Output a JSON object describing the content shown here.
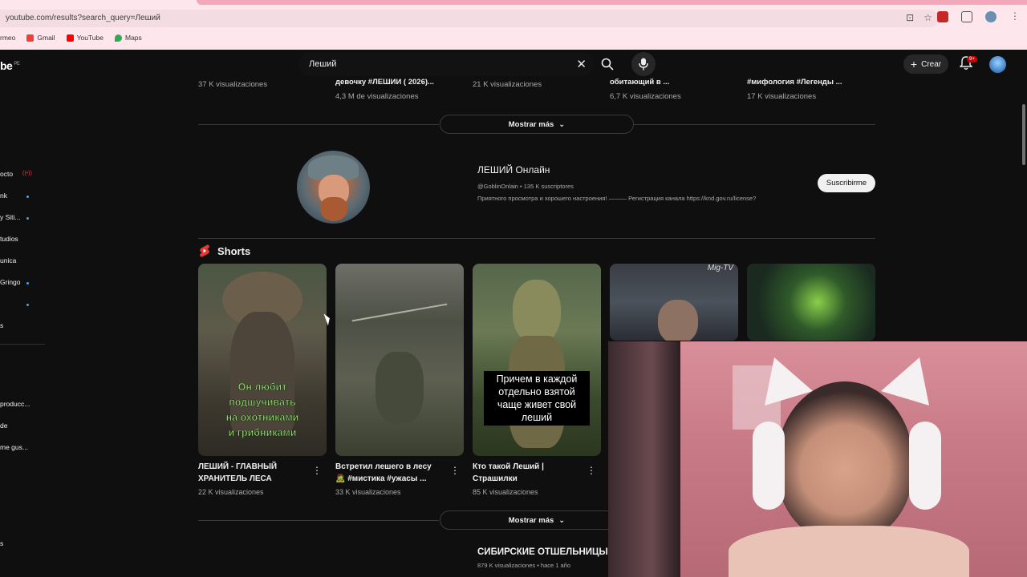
{
  "browser": {
    "url": "youtube.com/results?search_query=Леший",
    "bookmarks": [
      {
        "label": "rmeo"
      },
      {
        "label": "Gmail",
        "color": "#ea4335"
      },
      {
        "label": "YouTube",
        "color": "#ff0000"
      },
      {
        "label": "Maps",
        "color": "#34a853"
      }
    ]
  },
  "header": {
    "logo": "be",
    "logo_region": "PE",
    "search_value": "Леший",
    "create_label": "Crear",
    "notif_badge": "9+"
  },
  "sidebar": {
    "items": [
      {
        "label": "octo",
        "indicator": "live"
      },
      {
        "label": "nk",
        "indicator": "dot"
      },
      {
        "label": "y Siti...",
        "indicator": "dot"
      },
      {
        "label": "tudios",
        "indicator": ""
      },
      {
        "label": "unica",
        "indicator": ""
      },
      {
        "label": "Gringo",
        "indicator": "dot"
      },
      {
        "label": "",
        "indicator": "dot"
      },
      {
        "label": "s",
        "indicator": ""
      },
      {
        "label": "producc...",
        "indicator": ""
      },
      {
        "label": "de",
        "indicator": ""
      },
      {
        "label": "me gus...",
        "indicator": ""
      },
      {
        "label": "s",
        "indicator": ""
      }
    ]
  },
  "previous_row": [
    {
      "title": "",
      "meta": "37 K visualizaciones"
    },
    {
      "title": "девочку #ЛЕШИИ ( 2026)...",
      "meta": "4,3 M de visualizaciones"
    },
    {
      "title": "",
      "meta": "21 K visualizaciones"
    },
    {
      "title": "обитающий в ...",
      "meta": "6,7 K visualizaciones"
    },
    {
      "title": "#мифология #Легенды ...",
      "meta": "17 K visualizaciones"
    }
  ],
  "show_more": "Mostrar más",
  "channel": {
    "name": "ЛЕШИЙ Онлайн",
    "handle_meta": "@GoblinOnlain • 135 K suscriptores",
    "description": "Приятного просмотра и хорошего настроения! ——— Регистрация канала https://knd.gov.ru/license?",
    "subscribe_label": "Suscribirme"
  },
  "shorts": {
    "heading": "Shorts",
    "items": [
      {
        "title": "ЛЕШИЙ - ГЛАВНЫЙ ХРАНИТЕЛЬ ЛЕСА",
        "views": "22 K visualizaciones",
        "overlay": [
          "Он любит",
          "подшучивать",
          "на охотниками",
          "и грибниками"
        ]
      },
      {
        "title": "Встретил лешего в лесу 🧟 #мистика #ужасы ...",
        "views": "33 K visualizaciones"
      },
      {
        "title": "Кто такой Леший | Страшилки",
        "views": "85 K visualizaciones",
        "overlay": [
          "Причем в каждой",
          "отдельно взятой",
          "чаще живет свой",
          "леший"
        ]
      },
      {
        "title": "",
        "views": "",
        "overlay_label": "Mig-TV"
      },
      {
        "title": "",
        "views": ""
      }
    ]
  },
  "bottom_result": {
    "title": "СИБИРСКИЕ ОТШЕЛЬНИЦЫ.",
    "meta": "879 K visualizaciones • hace 1 año"
  }
}
